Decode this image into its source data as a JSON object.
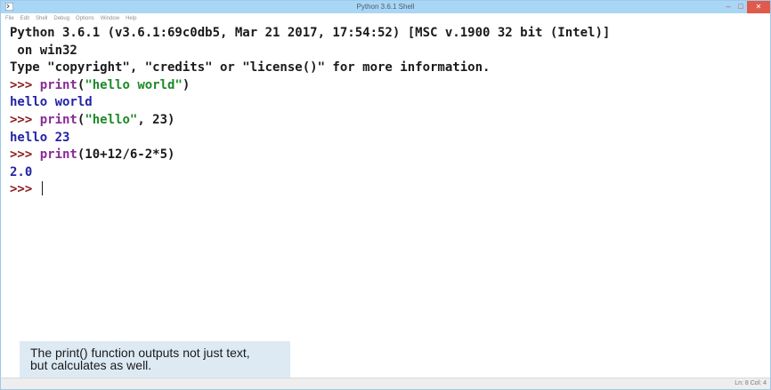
{
  "window": {
    "title": "Python 3.6.1 Shell",
    "controls": {
      "minimize": "–",
      "maximize": "□",
      "close": "✕"
    }
  },
  "menu": [
    "File",
    "Edit",
    "Shell",
    "Debug",
    "Options",
    "Window",
    "Help"
  ],
  "shell": {
    "banner": [
      "Python 3.6.1 (v3.6.1:69c0db5, Mar 21 2017, 17:54:52) [MSC v.1900 32 bit (Intel)]",
      " on win32",
      "Type \"copyright\", \"credits\" or \"license()\" for more information."
    ],
    "prompt": ">>> ",
    "cmd1": {
      "fn": "print",
      "open": "(",
      "arg": "\"hello world\"",
      "close": ")"
    },
    "out1": "hello world",
    "cmd2": {
      "fn": "print",
      "open": "(",
      "arg": "\"hello\"",
      "rest": ", 23)"
    },
    "out2": "hello 23",
    "cmd3": {
      "fn": "print",
      "rest": "(10+12/6-2*5)"
    },
    "out3": "2.0"
  },
  "caption": {
    "line1": "The print() function outputs not just text,",
    "line2": "but calculates as well."
  },
  "status": "Ln: 8  Col: 4",
  "colors": {
    "titlebar": "#a9d6f5",
    "prompt": "#8b1c1c",
    "builtin": "#8b2a98",
    "string": "#1c8a28",
    "output": "#2323a5",
    "caption_bg": "#ddeaf4"
  },
  "icons": {
    "app": "python-idle-icon"
  }
}
